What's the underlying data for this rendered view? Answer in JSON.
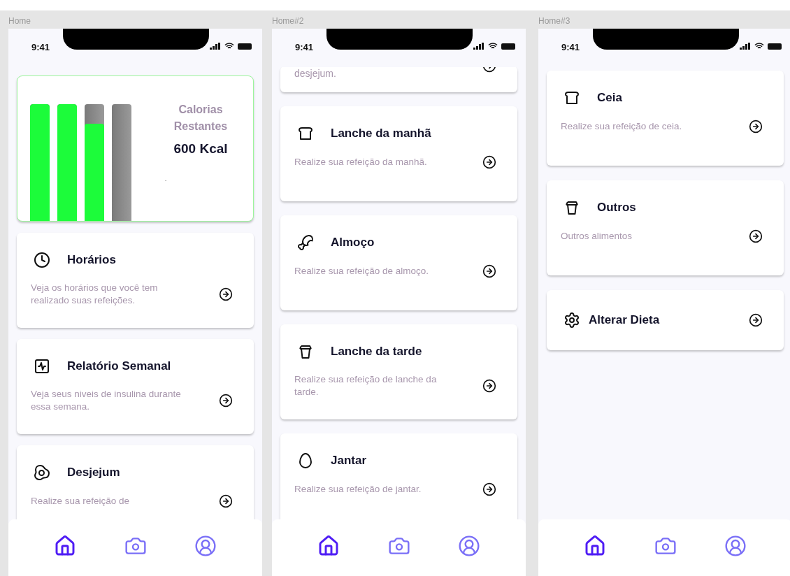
{
  "screens": [
    {
      "label": "Home",
      "time": "9:41",
      "calories": {
        "title": "Calorias Restantes",
        "value": "600 Kcal",
        "note": "-",
        "bars": [
          {
            "level": 1
          },
          {
            "level": 1
          },
          {
            "level": 0.83
          },
          {
            "level": 0
          }
        ]
      },
      "cards": [
        {
          "kind": "clock",
          "title": "Horários",
          "description": "Veja os horários que você tem realizado suas refeições."
        },
        {
          "kind": "report",
          "title": "Relatório Semanal",
          "description": "Veja seus niveis de insulina durante essa semana."
        },
        {
          "kind": "fried-egg",
          "title": "Desjejum",
          "description": "Realize sua refeição de"
        }
      ],
      "nav": [
        {
          "kind": "home",
          "selected": true
        },
        {
          "kind": "camera",
          "selected": false
        },
        {
          "kind": "profile",
          "selected": false
        }
      ]
    },
    {
      "label": "Home#2",
      "time": "9:41",
      "cards": [
        {
          "kind": "partial",
          "description": "desjejum."
        },
        {
          "kind": "toast",
          "title": "Lanche da manhã",
          "description": "Realize sua refeição da manhã."
        },
        {
          "kind": "drumstick",
          "title": "Almoço",
          "description": "Realize sua refeição de almoço."
        },
        {
          "kind": "cup",
          "title": "Lanche da tarde",
          "description": "Realize sua refeição de lanche da tarde."
        },
        {
          "kind": "egg",
          "title": "Jantar",
          "description": "Realize sua refeição de jantar."
        }
      ],
      "nav": [
        {
          "kind": "home",
          "selected": true
        },
        {
          "kind": "camera",
          "selected": false
        },
        {
          "kind": "profile",
          "selected": false
        }
      ]
    },
    {
      "label": "Home#3",
      "time": "9:41",
      "cards": [
        {
          "kind": "toast",
          "title": "Ceia",
          "description": "Realize sua refeição de ceia."
        },
        {
          "kind": "cup",
          "title": "Outros",
          "description": "Outros alimentos"
        },
        {
          "kind": "gear",
          "title": "Alterar Dieta"
        }
      ],
      "nav": [
        {
          "kind": "home",
          "selected": true
        },
        {
          "kind": "camera",
          "selected": false
        },
        {
          "kind": "profile",
          "selected": false
        }
      ]
    }
  ]
}
